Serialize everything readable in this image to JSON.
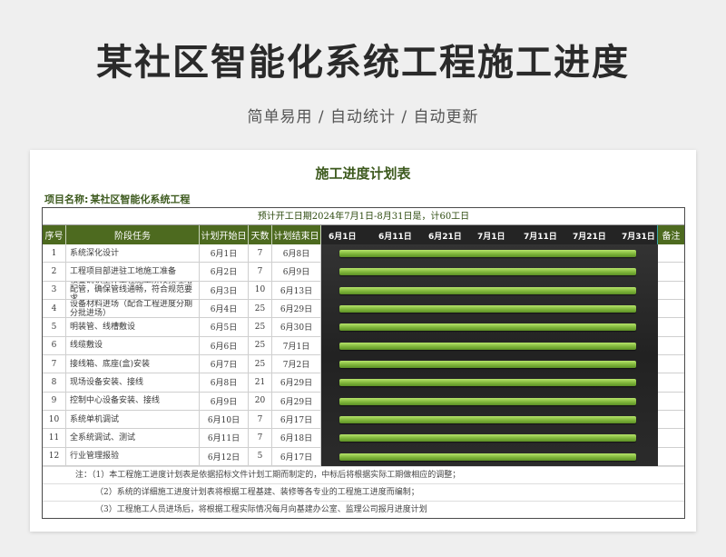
{
  "hero": {
    "title": "某社区智能化系统工程施工进度",
    "subtitle": "简单易用 / 自动统计 / 自动更新"
  },
  "sheet": {
    "title": "施工进度计划表",
    "project_label": "项目名称:",
    "project_name": "某社区智能化系统工程",
    "banner": "预计开工日期2024年7月1日-8月31日是，计60工日",
    "headers": {
      "no": "序号",
      "task": "阶段任务",
      "start": "计划开始日",
      "days": "天数",
      "end": "计划结束日",
      "note": "备注"
    },
    "gantt_dates": [
      "6月1日",
      "6月11日",
      "6月21日",
      "7月1日",
      "7月11日",
      "7月21日",
      "7月31日"
    ],
    "rows": [
      {
        "no": "1",
        "task": "系统深化设计",
        "start": "6月1日",
        "days": "7",
        "end": "6月8日"
      },
      {
        "no": "2",
        "task": "工程项目部进驻工地施工准备",
        "start": "6月2日",
        "days": "7",
        "end": "6月9日"
      },
      {
        "no": "3",
        "task": "核查确认主体工程施工阶段预埋暗配管，确保管线通畅，符合规范要求",
        "start": "6月3日",
        "days": "10",
        "end": "6月13日"
      },
      {
        "no": "4",
        "task": "设备材料进场（配合工程进度分期分批进场）",
        "start": "6月4日",
        "days": "25",
        "end": "6月29日"
      },
      {
        "no": "5",
        "task": "明装管、线槽敷设",
        "start": "6月5日",
        "days": "25",
        "end": "6月30日"
      },
      {
        "no": "6",
        "task": "线缆敷设",
        "start": "6月6日",
        "days": "25",
        "end": "7月1日"
      },
      {
        "no": "7",
        "task": "接线箱、底座(盒)安装",
        "start": "6月7日",
        "days": "25",
        "end": "7月2日"
      },
      {
        "no": "8",
        "task": "现场设备安装、接线",
        "start": "6月8日",
        "days": "21",
        "end": "6月29日"
      },
      {
        "no": "9",
        "task": "控制中心设备安装、接线",
        "start": "6月9日",
        "days": "20",
        "end": "6月29日"
      },
      {
        "no": "10",
        "task": "系统单机调试",
        "start": "6月10日",
        "days": "7",
        "end": "6月17日"
      },
      {
        "no": "11",
        "task": "全系统调试、测试",
        "start": "6月11日",
        "days": "7",
        "end": "6月18日"
      },
      {
        "no": "12",
        "task": "行业管理报验",
        "start": "6月12日",
        "days": "5",
        "end": "6月17日"
      }
    ],
    "notes": [
      "注：（1）本工程施工进度计划表是依据招标文件计划工期而制定的，中标后将根据实际工期做相应的调整；",
      "（2）系统的详细施工进度计划表将根据工程基建、装修等各专业的工程施工进度而编制；",
      "（3）工程施工人员进场后，将根据工程实际情况每月向基建办公室、监理公司报月进度计划"
    ]
  },
  "colors": {
    "header_green": "#4d6a1f",
    "bar_green": "#8cc63f",
    "gantt_dark": "#242424"
  }
}
